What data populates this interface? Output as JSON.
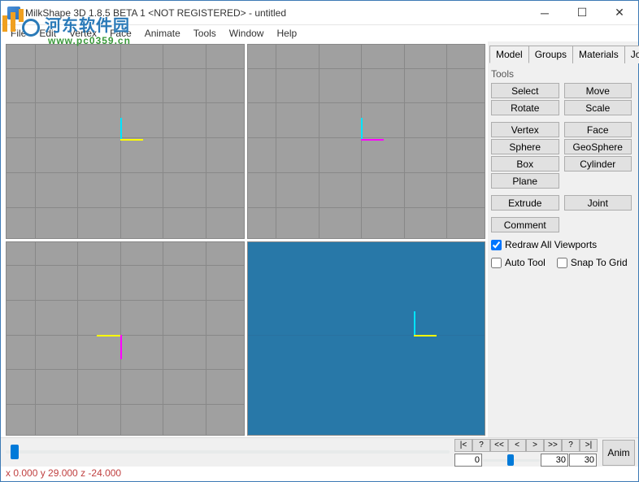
{
  "window": {
    "title": "MilkShape 3D 1.8.5 BETA 1 <NOT REGISTERED> - untitled"
  },
  "menu": {
    "items": [
      "File",
      "Edit",
      "Vertex",
      "Face",
      "Animate",
      "Tools",
      "Window",
      "Help"
    ]
  },
  "watermark": {
    "cn_text": "河东软件园",
    "url": "www.pc0359.cn"
  },
  "tabs": {
    "items": [
      "Model",
      "Groups",
      "Materials",
      "Joints"
    ],
    "active": 0
  },
  "tools_panel": {
    "header": "Tools",
    "group1": [
      "Select",
      "Move",
      "Rotate",
      "Scale"
    ],
    "group2": [
      "Vertex",
      "Face",
      "Sphere",
      "GeoSphere",
      "Box",
      "Cylinder",
      "Plane"
    ],
    "group3": [
      "Extrude",
      "Joint"
    ],
    "group4": [
      "Comment"
    ],
    "redraw_label": "Redraw All Viewports",
    "redraw_checked": true,
    "auto_tool_label": "Auto Tool",
    "auto_tool_checked": false,
    "snap_label": "Snap To Grid",
    "snap_checked": false
  },
  "timeline": {
    "buttons": [
      "|<",
      "?",
      "<<",
      "<",
      ">",
      ">>",
      "?",
      ">|"
    ],
    "frame_start": "0",
    "frame_cur": "30",
    "frame_end": "30",
    "anim_label": "Anim"
  },
  "status": {
    "coords": "x 0.000 y 29.000 z -24.000"
  }
}
